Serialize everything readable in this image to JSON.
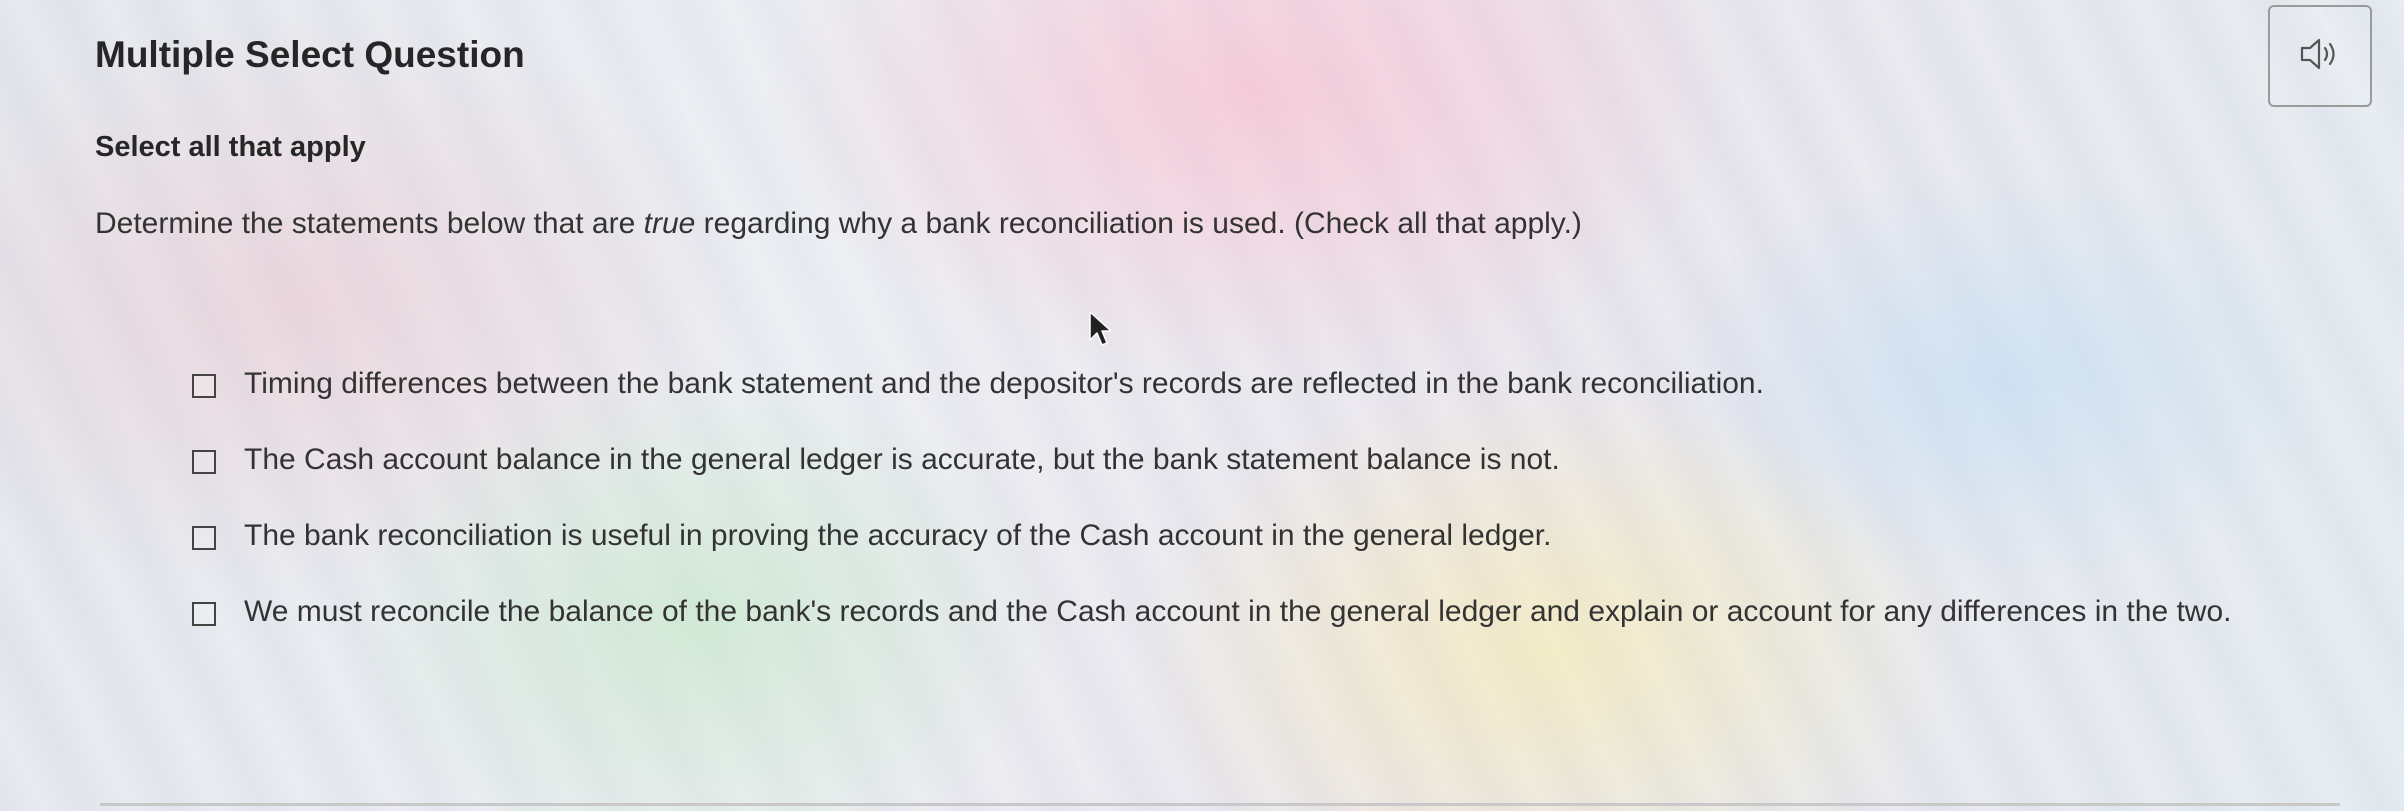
{
  "question": {
    "title": "Multiple Select Question",
    "instruction": "Select all that apply",
    "prompt_before": "Determine the statements below that are ",
    "prompt_emphasis": "true",
    "prompt_after": " regarding why a bank reconciliation is used. (Check all that apply.)",
    "audio_icon": "speaker-icon"
  },
  "options": [
    {
      "label": "Timing differences between the bank statement and the depositor's records are reflected in the bank reconciliation.",
      "checked": false
    },
    {
      "label": "The Cash account balance in the general ledger is accurate, but the bank statement balance is not.",
      "checked": false
    },
    {
      "label": "The bank reconciliation is useful in proving the accuracy of the Cash account in the general ledger.",
      "checked": false
    },
    {
      "label": "We must reconcile the balance of the bank's records and the Cash account in the general ledger and explain or account for any differences in the two.",
      "checked": false
    }
  ]
}
